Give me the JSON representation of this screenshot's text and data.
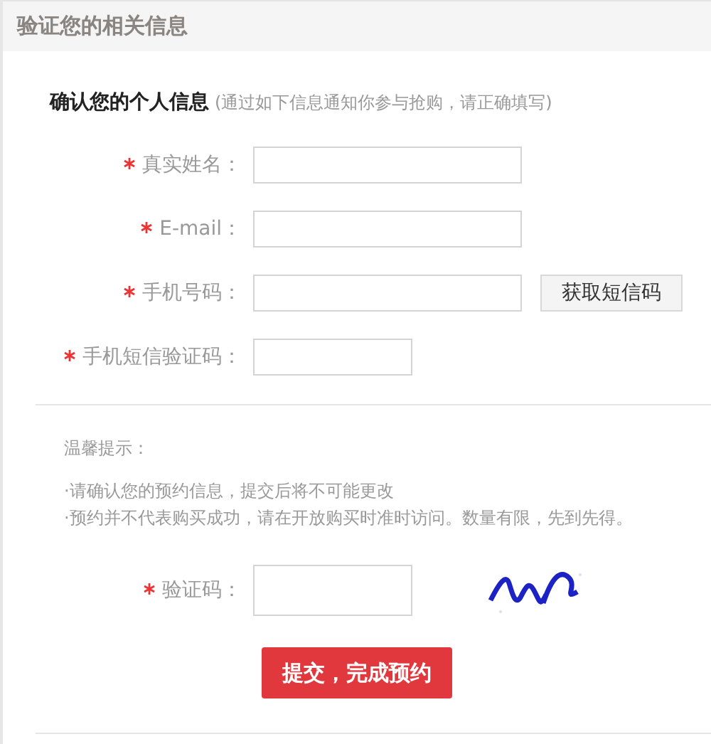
{
  "header": {
    "title": "验证您的相关信息"
  },
  "section": {
    "title": "确认您的个人信息",
    "note": "(通过如下信息通知你参与抢购，请正确填写)"
  },
  "fields": [
    {
      "kind": "text",
      "label": "真实姓名：",
      "required": true
    },
    {
      "kind": "text",
      "label": "E-mail：",
      "required": true
    },
    {
      "kind": "sms",
      "label": "手机号码：",
      "required": true,
      "button": "获取短信码"
    },
    {
      "kind": "short",
      "label": "手机短信验证码：",
      "required": true
    }
  ],
  "tips": {
    "title": "温馨提示：",
    "lines": [
      "·请确认您的预约信息，提交后将不可能更改",
      "·预约并不代表购买成功，请在开放购买时准时访问。数量有限，先到先得。"
    ]
  },
  "captcha": {
    "label": "验证码：",
    "required": true,
    "kind": "picture"
  },
  "submit": {
    "label": "提交，完成预约"
  }
}
